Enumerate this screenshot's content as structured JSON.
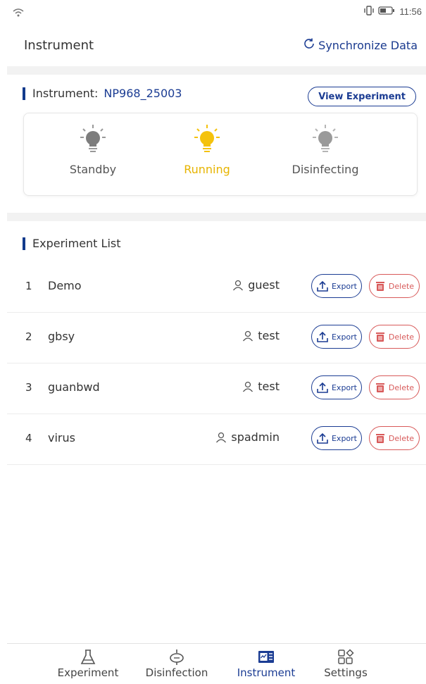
{
  "status_bar": {
    "time": "11:56"
  },
  "header": {
    "title": "Instrument",
    "sync_label": "Synchronize Data"
  },
  "instrument": {
    "label": "Instrument:",
    "id": "NP968_25003",
    "view_button": "View Experiment",
    "states": [
      {
        "label": "Standby",
        "active": false
      },
      {
        "label": "Running",
        "active": true
      },
      {
        "label": "Disinfecting",
        "active": false
      }
    ]
  },
  "experiment_list": {
    "title": "Experiment List",
    "export_label": "Export",
    "delete_label": "Delete",
    "rows": [
      {
        "index": "1",
        "name": "Demo",
        "user": "guest"
      },
      {
        "index": "2",
        "name": "gbsy",
        "user": "test"
      },
      {
        "index": "3",
        "name": "guanbwd",
        "user": "test"
      },
      {
        "index": "4",
        "name": "virus",
        "user": "spadmin"
      }
    ]
  },
  "nav": {
    "items": [
      {
        "label": "Experiment"
      },
      {
        "label": "Disinfection"
      },
      {
        "label": "Instrument"
      },
      {
        "label": "Settings"
      }
    ]
  },
  "colors": {
    "accent": "#1b3c93",
    "running": "#f4c20d",
    "danger": "#d85a5a"
  }
}
